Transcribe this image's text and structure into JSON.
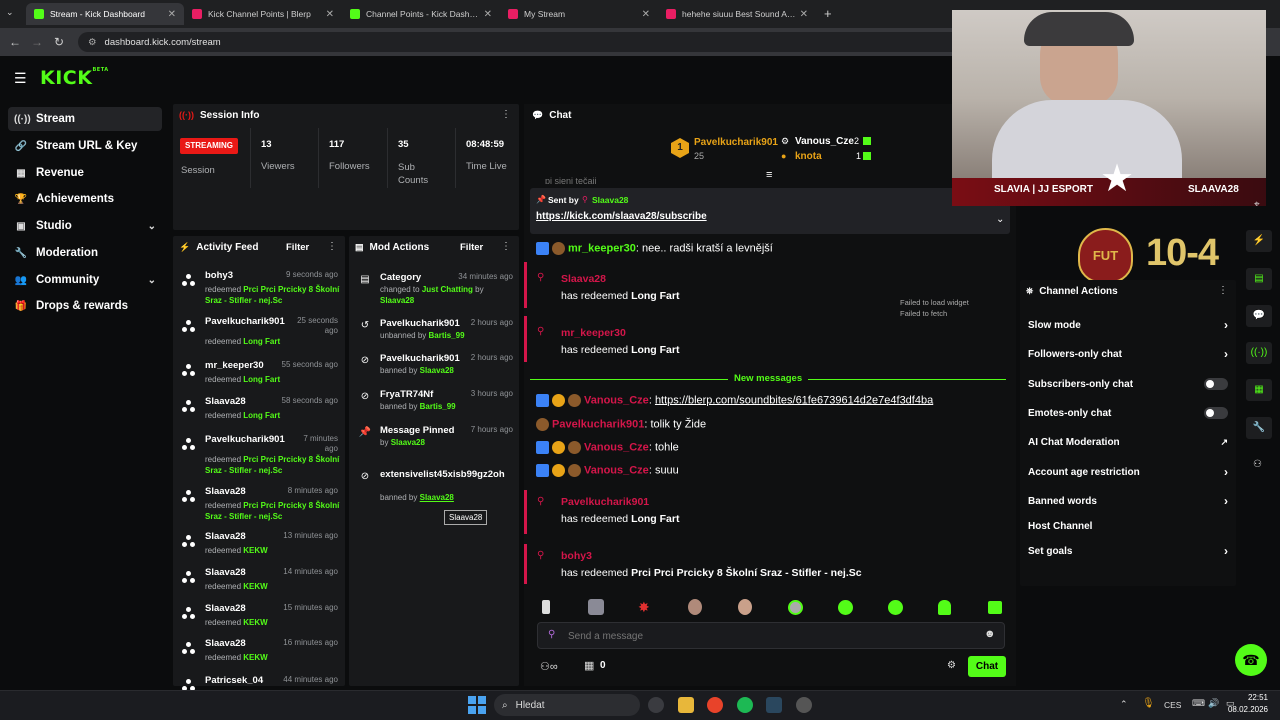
{
  "browser": {
    "tabs": [
      {
        "title": "Stream - Kick Dashboard",
        "color": "#53fc18"
      },
      {
        "title": "Kick Channel Points | Blerp",
        "color": "#e91e63"
      },
      {
        "title": "Channel Points - Kick Dashboard",
        "color": "#53fc18"
      },
      {
        "title": "My Stream",
        "color": "#e91e63"
      },
      {
        "title": "hehehe siuuu Best Sound Alert",
        "color": "#e91e63"
      }
    ],
    "url": "dashboard.kick.com/stream"
  },
  "brand": {
    "logo": "KICK",
    "beta": "BETA",
    "accent": "#53fc18"
  },
  "sidebar": {
    "items": [
      {
        "label": "Stream",
        "icon": "broadcast-icon"
      },
      {
        "label": "Stream URL & Key",
        "icon": "link-icon"
      },
      {
        "label": "Revenue",
        "icon": "revenue-icon"
      },
      {
        "label": "Achievements",
        "icon": "trophy-icon"
      },
      {
        "label": "Studio",
        "icon": "studio-icon"
      },
      {
        "label": "Moderation",
        "icon": "wrench-icon"
      },
      {
        "label": "Community",
        "icon": "community-icon"
      },
      {
        "label": "Drops & rewards",
        "icon": "gift-icon"
      }
    ]
  },
  "session": {
    "title": "Session Info",
    "status": "STREAMING",
    "session_label": "Session",
    "stats": [
      {
        "value": "13",
        "label": "Viewers"
      },
      {
        "value": "117",
        "label": "Followers"
      },
      {
        "value": "35",
        "label": "Sub Counts"
      },
      {
        "value": "08:48:59",
        "label": "Time Live"
      }
    ]
  },
  "activity": {
    "title": "Activity Feed",
    "filter": "Filter",
    "items": [
      {
        "name": "bohy3",
        "time": "9 seconds ago",
        "line1": "redeemed",
        "reward": "Prci Prci Prcicky 8 Školní Sraz - Stifler - nej.Sc"
      },
      {
        "name": "Pavelkucharik901",
        "time": "25 seconds ago",
        "line1": "redeemed",
        "reward": "Long Fart"
      },
      {
        "name": "mr_keeper30",
        "time": "55 seconds ago",
        "line1": "redeemed",
        "reward": "Long Fart"
      },
      {
        "name": "Slaava28",
        "time": "58 seconds ago",
        "line1": "redeemed",
        "reward": "Long Fart"
      },
      {
        "name": "Pavelkucharik901",
        "time": "7 minutes ago",
        "line1": "redeemed",
        "reward": "Prci Prci Prcicky 8 Školní Sraz - Stifler - nej.Sc"
      },
      {
        "name": "Slaava28",
        "time": "8 minutes ago",
        "line1": "redeemed",
        "reward": "Prci Prci Prcicky 8 Školní Sraz - Stifler - nej.Sc"
      },
      {
        "name": "Slaava28",
        "time": "13 minutes ago",
        "line1": "redeemed",
        "reward": "KEKW"
      },
      {
        "name": "Slaava28",
        "time": "14 minutes ago",
        "line1": "redeemed",
        "reward": "KEKW"
      },
      {
        "name": "Slaava28",
        "time": "15 minutes ago",
        "line1": "redeemed",
        "reward": "KEKW"
      },
      {
        "name": "Slaava28",
        "time": "16 minutes ago",
        "line1": "redeemed",
        "reward": "KEKW"
      },
      {
        "name": "Patricsek_04",
        "time": "44 minutes ago"
      }
    ]
  },
  "mod": {
    "title": "Mod Actions",
    "filter": "Filter",
    "items": [
      {
        "name": "Category",
        "time": "34 minutes ago",
        "line": "changed to",
        "hl": "Just Chatting",
        "line2": "by",
        "by": "Slaava28"
      },
      {
        "name": "Pavelkucharik901",
        "time": "2 hours ago",
        "line": "unbanned by",
        "by": "Bartis_99"
      },
      {
        "name": "Pavelkucharik901",
        "time": "2 hours ago",
        "line": "banned by",
        "by": "Slaava28"
      },
      {
        "name": "FryaTR74Nf",
        "time": "3 hours ago",
        "line": "banned by",
        "by": "Bartis_99"
      },
      {
        "name": "Message Pinned",
        "time": "7 hours ago",
        "line": "by",
        "by": "Slaava28"
      },
      {
        "name": "extensivelist45xisb99gz2oh",
        "time": "",
        "line": "banned by",
        "by": "Slaava28"
      }
    ],
    "tooltip": "Slaava28"
  },
  "chat": {
    "title": "Chat",
    "leaders": [
      {
        "rank": "1",
        "name": "Pavelkucharik901",
        "value": "25"
      },
      {
        "name": "Vanous_Cze",
        "value": "2"
      },
      {
        "name": "knota",
        "value": "1"
      }
    ],
    "partial": "pi sjeni tečaji",
    "pinned": {
      "label": "Sent by",
      "by": "Slaava28",
      "text": "https://kick.com/slaava28/subscribe"
    },
    "msg1": {
      "user": "mr_keeper30",
      "text": "nee.. radši kratší a levnější"
    },
    "redeems": [
      {
        "user": "Slaava28",
        "text": "has redeemed",
        "reward": "Long Fart"
      },
      {
        "user": "mr_keeper30",
        "text": "has redeemed",
        "reward": "Long Fart"
      },
      {
        "user": "Pavelkucharik901",
        "text": "has redeemed",
        "reward": "Long Fart"
      },
      {
        "user": "bohy3",
        "text": "has redeemed",
        "reward": "Prci Prci Prcicky 8 Školní Sraz - Stifler - nej.Sc"
      }
    ],
    "widget_error": [
      "Failed to load widget",
      "Failed to fetch"
    ],
    "new_messages": "New messages",
    "msgs": [
      {
        "user": "Vanous_Cze",
        "text": "https://blerp.com/soundbites/61fe6739614d2e7e4f3df4ba"
      },
      {
        "user": "Pavelkucharik901",
        "text": "tolik ty Žide"
      },
      {
        "user": "Vanous_Cze",
        "text": "tohle"
      },
      {
        "user": "Vanous_Cze",
        "text": "suuu"
      }
    ],
    "placeholder": "Send a message",
    "points": "0",
    "send": "Chat"
  },
  "overlay": {
    "left": "SLAVIA | JJ ESPORT",
    "right": "SLAAVA28",
    "fut": "FUT",
    "score": "10-4"
  },
  "actions": {
    "title": "Channel Actions",
    "items": [
      {
        "label": "Slow mode",
        "kind": "chevron"
      },
      {
        "label": "Followers-only chat",
        "kind": "chevron"
      },
      {
        "label": "Subscribers-only chat",
        "kind": "toggle"
      },
      {
        "label": "Emotes-only chat",
        "kind": "toggle"
      },
      {
        "label": "AI Chat Moderation",
        "kind": "external"
      },
      {
        "label": "Account age restriction",
        "kind": "chevron"
      },
      {
        "label": "Banned words",
        "kind": "chevron"
      },
      {
        "label": "Host Channel",
        "kind": "none"
      },
      {
        "label": "Set goals",
        "kind": "chevron"
      }
    ]
  },
  "taskbar": {
    "search": "Hledat",
    "lang": "CES",
    "time": "22:51",
    "date": "08.02.2026"
  }
}
